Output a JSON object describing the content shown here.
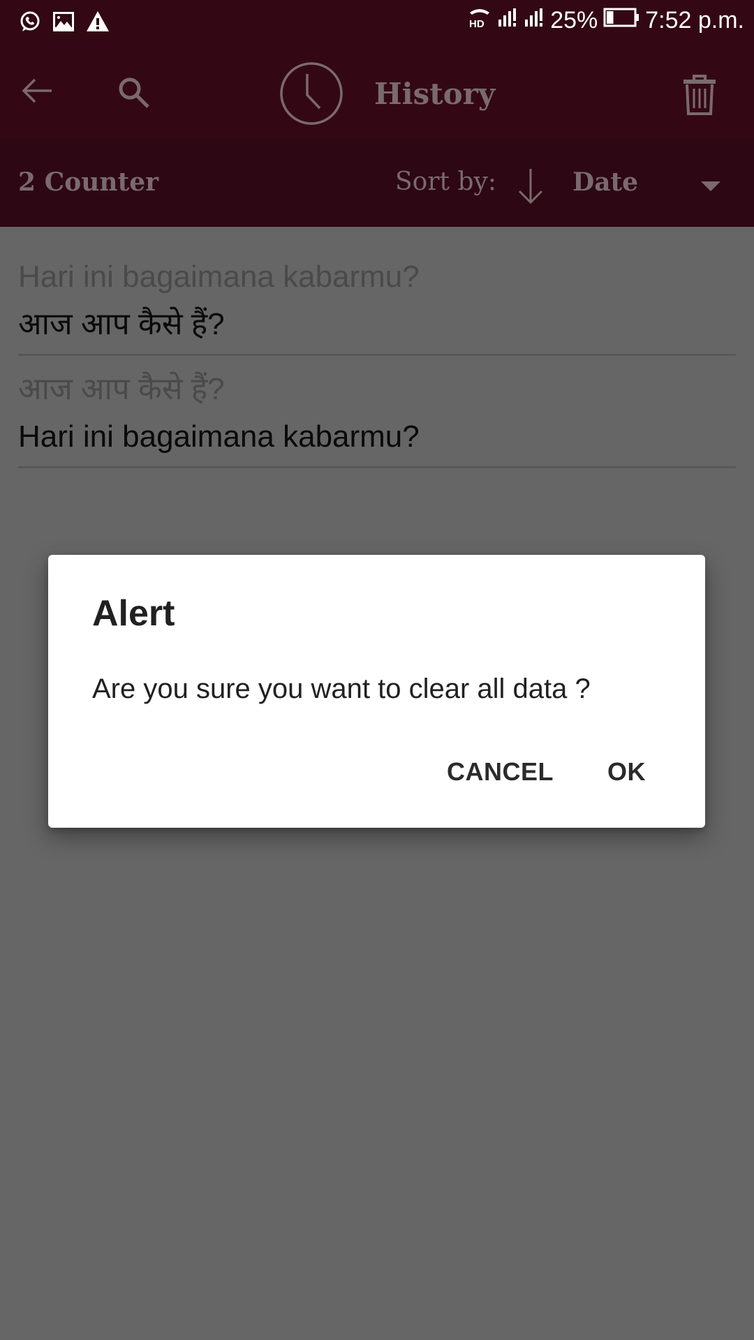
{
  "status_bar": {
    "left_icons": [
      "whatsapp-icon",
      "image-icon",
      "warning-icon"
    ],
    "right_icons": [
      "hd-call-icon",
      "signal-sim1-icon",
      "signal-sim2-icon",
      "battery-icon"
    ],
    "battery_percent": "25%",
    "battery_level": 0.25,
    "time": "7:52 p.m."
  },
  "toolbar": {
    "back_icon": "arrow-left-icon",
    "search_icon": "search-icon",
    "title_icon": "clock-icon",
    "title": "History",
    "delete_icon": "trash-icon"
  },
  "sortbar": {
    "counter": "2 Counter",
    "sort_label": "Sort by:",
    "sort_direction_icon": "arrow-down-icon",
    "sort_value": "Date",
    "dropdown_icon": "caret-down-icon"
  },
  "history": [
    {
      "source": "Hari ini bagaimana kabarmu?",
      "translation": "आज आप कैसे हैं?"
    },
    {
      "source": "आज आप कैसे हैं?",
      "translation": "Hari ini bagaimana kabarmu?"
    }
  ],
  "dialog": {
    "title": "Alert",
    "message": "Are you sure you want to clear all data ?",
    "cancel_label": "CANCEL",
    "ok_label": "OK"
  },
  "colors": {
    "toolbar_dimmed": "#330814",
    "scrim_background": "#666666",
    "dialog_background": "#ffffff",
    "dialog_text": "#212121"
  }
}
